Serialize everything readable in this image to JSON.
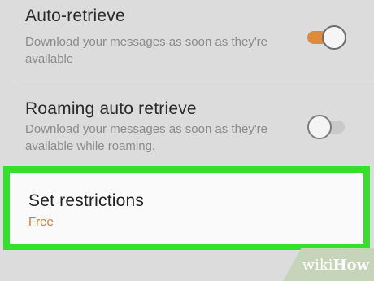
{
  "settings": {
    "auto_retrieve": {
      "title": "Auto-retrieve",
      "description": "Download your messages as soon as they're available",
      "toggle_state": "on"
    },
    "roaming_auto_retrieve": {
      "title": "Roaming auto retrieve",
      "description": "Download your messages as soon as they're available while roaming.",
      "toggle_state": "off"
    },
    "set_restrictions": {
      "title": "Set restrictions",
      "value": "Free"
    }
  },
  "colors": {
    "accent": "#e08a3b",
    "highlight_border": "#34e02c",
    "background": "#dcdcdc"
  },
  "watermark": {
    "part1": "wiki",
    "part2": "How"
  }
}
